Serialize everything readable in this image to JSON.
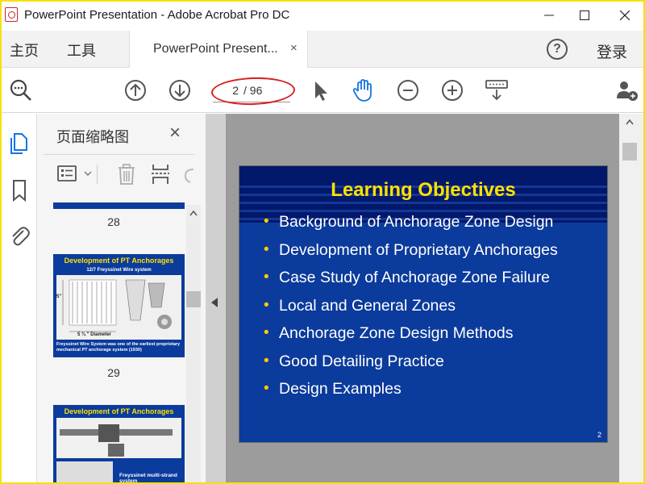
{
  "window": {
    "title": "PowerPoint Presentation - Adobe Acrobat Pro DC"
  },
  "menubar": {
    "home": "主页",
    "tools": "工具",
    "tab_label": "PowerPoint Present...",
    "tab_close": "×",
    "help": "?",
    "login": "登录"
  },
  "toolbar": {
    "page_input": "2",
    "page_total": "/ 96"
  },
  "panel": {
    "title": "页面缩略图",
    "close": "×",
    "thumbnails": [
      {
        "page": "28"
      },
      {
        "page": "29",
        "title": "Development of PT Anchorages",
        "subtitle": "12/7 Freyssinet Wire system",
        "label_height": "5\"",
        "label_diameter": "5 ¾ \" Diameter",
        "caption": "Freyssinet Wire System was one of the earliest proprietary mechanical PT anchorage system (1930)"
      },
      {
        "title": "Development of PT Anchorages",
        "caption": "Freyssinet multi-strand system"
      }
    ]
  },
  "slide": {
    "title": "Learning Objectives",
    "bullets": [
      "Background of Anchorage Zone Design",
      "Development of Proprietary Anchorages",
      "Case Study of Anchorage Zone Failure",
      "Local and General Zones",
      "Anchorage Zone Design Methods",
      "Good Detailing Practice",
      "Design Examples"
    ],
    "number": "2"
  },
  "colors": {
    "slide_bg": "#0b3b9c",
    "slide_title": "#ffe100",
    "bullet": "#ffcc00",
    "highlight": "#d81e1e",
    "accent": "#1473e6"
  }
}
